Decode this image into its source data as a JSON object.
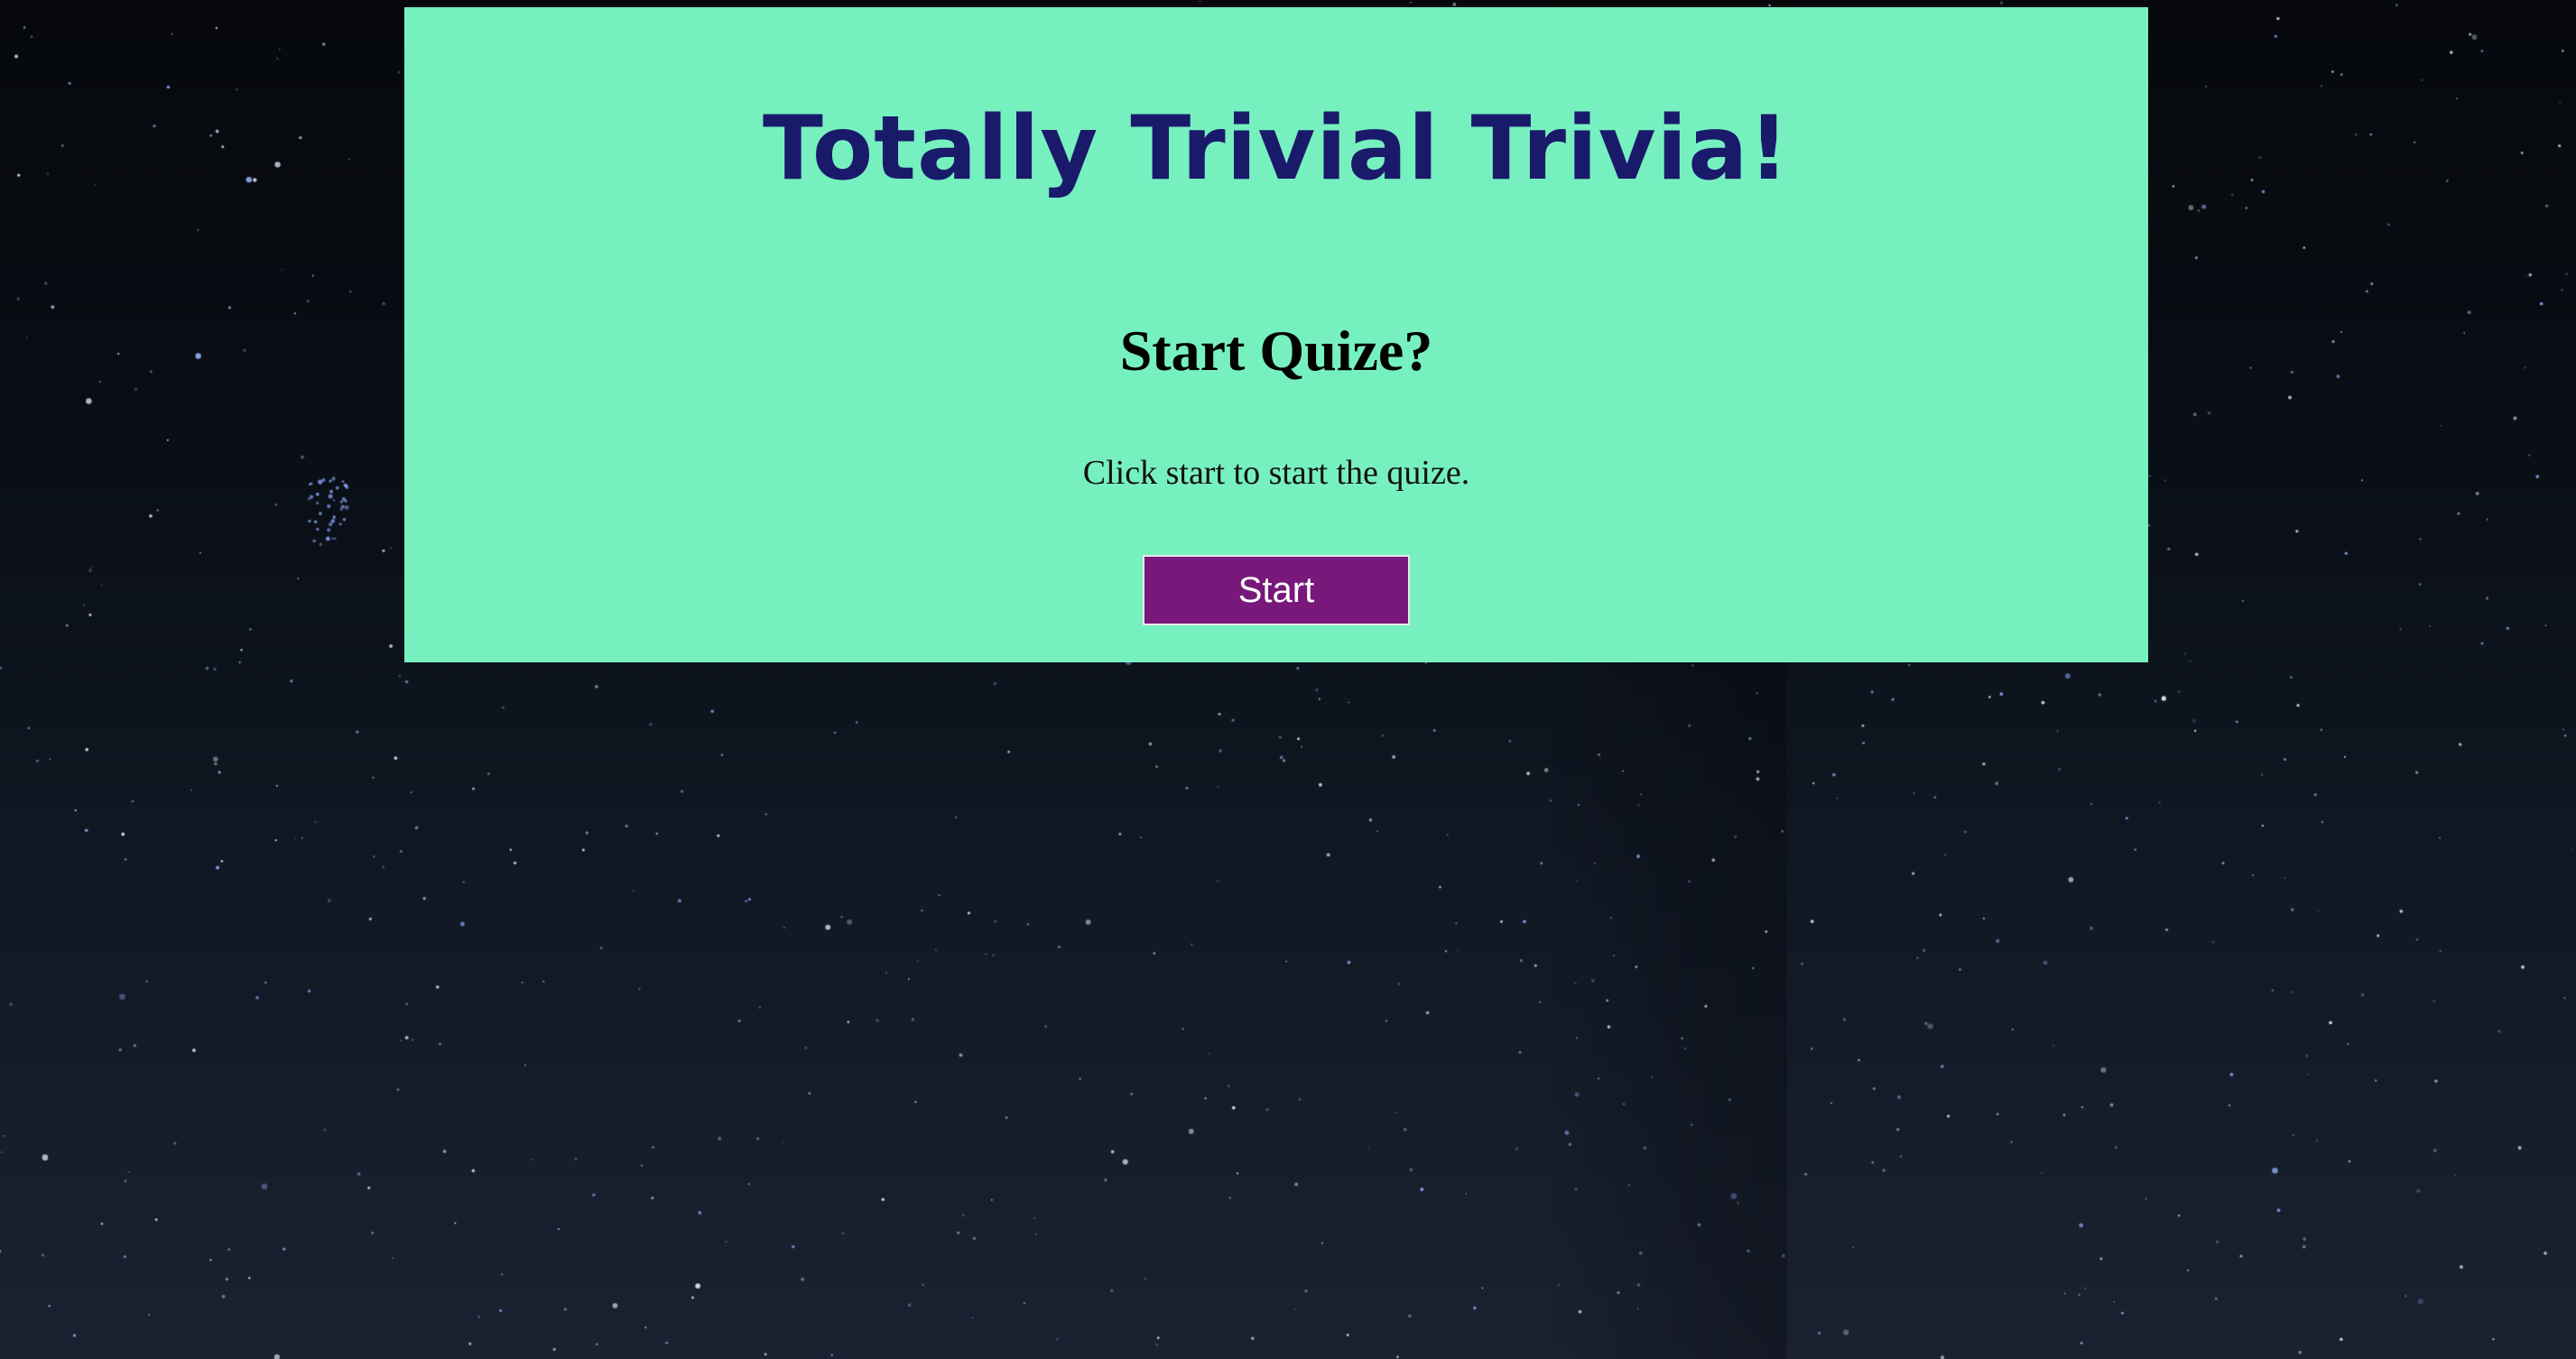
{
  "page": {
    "title": "Totally Trivial Trivia!",
    "heading": "Start Quize?",
    "instructions": "Click start to start the quize.",
    "start_button_label": "Start"
  },
  "colors": {
    "card_background": "#77f0c0",
    "title_color": "#1a1a6b",
    "button_background": "#77187a",
    "page_background": "#0a0f16"
  },
  "background": {
    "type": "starry-night-sky"
  }
}
